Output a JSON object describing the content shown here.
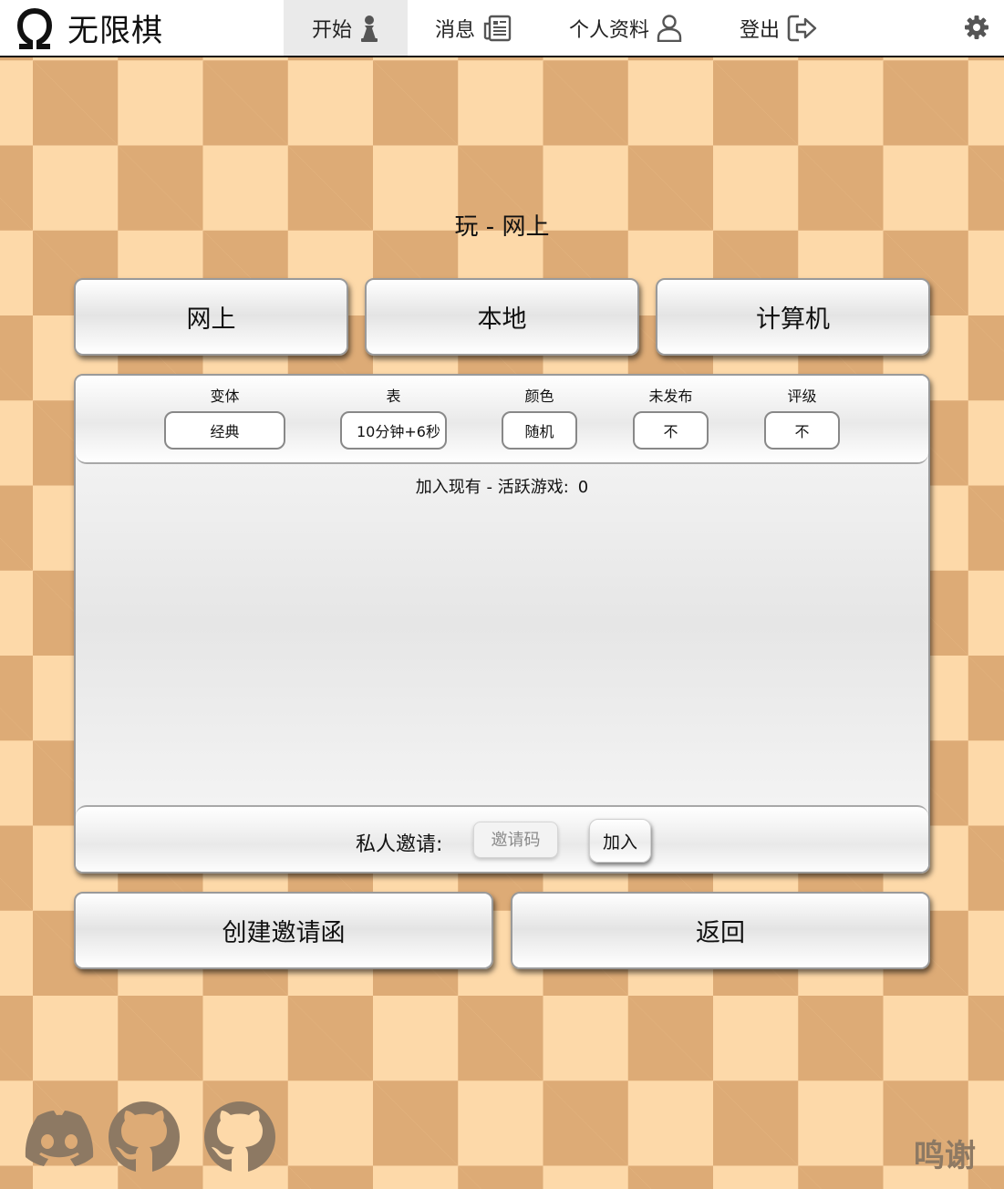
{
  "app": {
    "title": "无限棋",
    "logo_icon": "omega-icon"
  },
  "nav": {
    "items": [
      {
        "label": "开始",
        "icon": "pawn-icon",
        "active": true
      },
      {
        "label": "消息",
        "icon": "newspaper-icon",
        "active": false
      },
      {
        "label": "个人资料",
        "icon": "user-icon",
        "active": false
      },
      {
        "label": "登出",
        "icon": "logout-icon",
        "active": false
      }
    ],
    "settings_icon": "gear-icon"
  },
  "page": {
    "title": "玩 - 网上"
  },
  "mode_buttons": {
    "online": "网上",
    "local": "本地",
    "computer": "计算机"
  },
  "options": {
    "variant": {
      "label": "变体",
      "value": "经典"
    },
    "clock": {
      "label": "表",
      "value": "10分钟+6秒"
    },
    "color": {
      "label": "颜色",
      "value": "随机"
    },
    "unpublished": {
      "label": "未发布",
      "value": "不"
    },
    "rated": {
      "label": "评级",
      "value": "不"
    }
  },
  "join_existing": {
    "label": "加入现有 - 活跃游戏:",
    "count": "0"
  },
  "private_invite": {
    "label": "私人邀请:",
    "placeholder": "邀请码",
    "join_label": "加入"
  },
  "actions": {
    "create_invite": "创建邀请函",
    "back": "返回"
  },
  "footer": {
    "icons": [
      "discord-icon",
      "github-icon",
      "github-icon"
    ],
    "thanks": "鸣谢"
  },
  "colors": {
    "board_light": "#fdd9a9",
    "board_dark": "#ddab76",
    "footer_text": "#8d7963"
  }
}
